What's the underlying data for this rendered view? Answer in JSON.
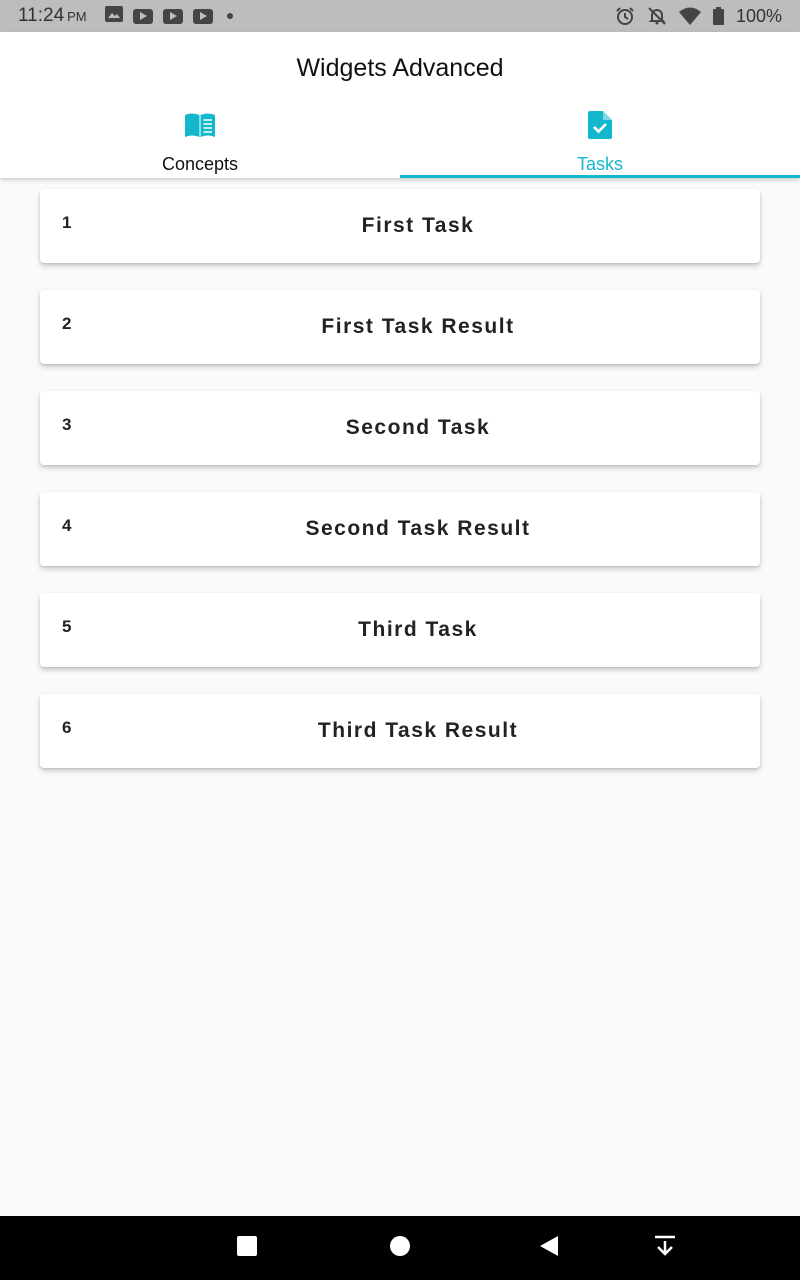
{
  "status_bar": {
    "time": "11:24",
    "ampm": "PM",
    "battery": "100%"
  },
  "app": {
    "title": "Widgets Advanced"
  },
  "tabs": [
    {
      "label": "Concepts",
      "icon": "book-icon",
      "selected": false
    },
    {
      "label": "Tasks",
      "icon": "task-document-icon",
      "selected": true
    }
  ],
  "tasks": [
    {
      "number": "1",
      "title": "First Task"
    },
    {
      "number": "2",
      "title": "First Task Result"
    },
    {
      "number": "3",
      "title": "Second Task"
    },
    {
      "number": "4",
      "title": "Second Task Result"
    },
    {
      "number": "5",
      "title": "Third Task"
    },
    {
      "number": "6",
      "title": "Third Task Result"
    }
  ],
  "nav": [
    "recents-icon",
    "home-icon",
    "back-icon",
    "notification-pull-icon"
  ],
  "colors": {
    "accent": "#14b8cc",
    "status_bar": "#bdbdbd",
    "background": "#fafafa"
  }
}
